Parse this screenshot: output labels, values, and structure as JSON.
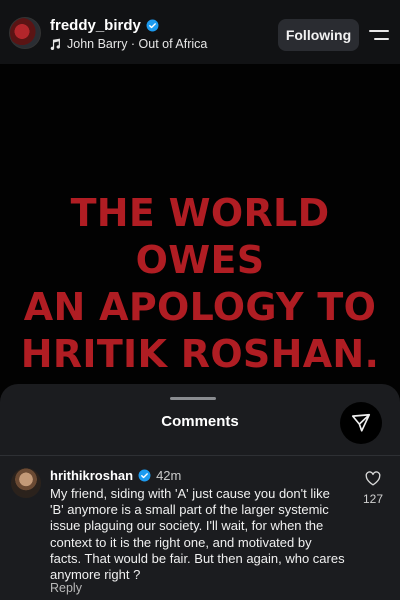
{
  "header": {
    "username": "freddy_birdy",
    "verified": true,
    "music": "John Barry · Out of Africa",
    "follow_button": "Following"
  },
  "post": {
    "text": "THE WORLD OWES\nAN APOLOGY TO\nHRITIK ROSHAN.",
    "text_color": "#b01d23",
    "background": "#020202"
  },
  "comments_sheet": {
    "title": "Comments",
    "comment": {
      "username": "hrithikroshan",
      "verified": true,
      "time": "42m",
      "text": "My friend, siding with 'A' just cause you don't like 'B' anymore is a small part of the larger systemic issue plaguing our society.  I'll wait, for when the context to it is the right one, and motivated by facts. That would be fair. But then again, who cares anymore right ?",
      "likes": "127",
      "reply_label": "Reply"
    }
  },
  "icons": {
    "verified": "verified-badge-icon",
    "music": "music-note-icon",
    "menu": "menu-icon",
    "share": "send-icon",
    "like": "heart-icon"
  },
  "colors": {
    "accent_verified": "#1d9bf0",
    "sheet_bg": "#1b1c1f",
    "button_bg": "#2a2c31"
  }
}
